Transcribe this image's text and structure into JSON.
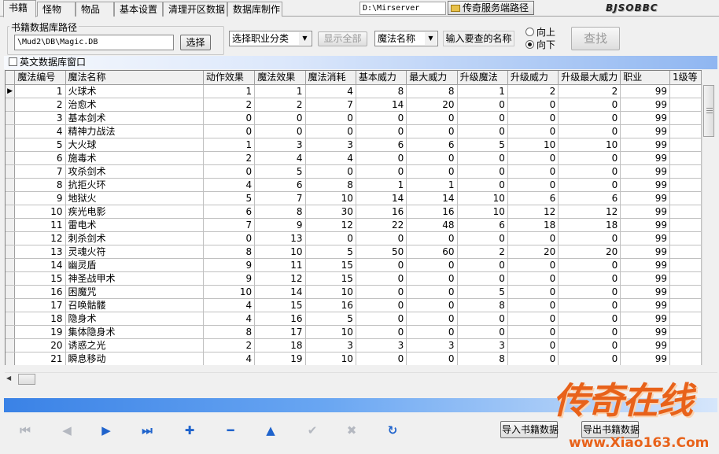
{
  "tabs": [
    {
      "label": "书籍",
      "active": true
    },
    {
      "label": "怪物",
      "active": false
    },
    {
      "label": "物品",
      "active": false
    },
    {
      "label": "基本设置",
      "active": false
    },
    {
      "label": "清理开区数据",
      "active": false
    },
    {
      "label": "数据库制作",
      "active": false
    }
  ],
  "server_path": "D:\\Mirserver",
  "server_path_button": "传奇服务端路径",
  "top_logo": "BJSOBBC",
  "db_group": {
    "title": "书籍数据库路径",
    "path": "\\Mud2\\DB\\Magic.DB",
    "select_label": "选择"
  },
  "filters": {
    "job_select": "选择职业分类",
    "show_all": "显示全部",
    "field_select": "魔法名称",
    "input_label": "输入要查的名称",
    "dir_up": "向上",
    "dir_down": "向下",
    "dir_selected": "down",
    "search": "查找"
  },
  "english_window": {
    "label": "英文数据库窗口",
    "checked": false
  },
  "grid": {
    "columns": [
      "魔法编号",
      "魔法名称",
      "动作效果",
      "魔法效果",
      "魔法消耗",
      "基本威力",
      "最大威力",
      "升级魔法",
      "升级威力",
      "升级最大威力",
      "职业",
      "1级等"
    ],
    "rows": [
      [
        "1",
        "火球术",
        "1",
        "1",
        "4",
        "8",
        "8",
        "1",
        "2",
        "2",
        "99"
      ],
      [
        "2",
        "治愈术",
        "2",
        "2",
        "7",
        "14",
        "20",
        "0",
        "0",
        "0",
        "99"
      ],
      [
        "3",
        "基本剑术",
        "0",
        "0",
        "0",
        "0",
        "0",
        "0",
        "0",
        "0",
        "99"
      ],
      [
        "4",
        "精神力战法",
        "0",
        "0",
        "0",
        "0",
        "0",
        "0",
        "0",
        "0",
        "99"
      ],
      [
        "5",
        "大火球",
        "1",
        "3",
        "3",
        "6",
        "6",
        "5",
        "10",
        "10",
        "99"
      ],
      [
        "6",
        "施毒术",
        "2",
        "4",
        "4",
        "0",
        "0",
        "0",
        "0",
        "0",
        "99"
      ],
      [
        "7",
        "攻杀剑术",
        "0",
        "5",
        "0",
        "0",
        "0",
        "0",
        "0",
        "0",
        "99"
      ],
      [
        "8",
        "抗拒火环",
        "4",
        "6",
        "8",
        "1",
        "1",
        "0",
        "0",
        "0",
        "99"
      ],
      [
        "9",
        "地狱火",
        "5",
        "7",
        "10",
        "14",
        "14",
        "10",
        "6",
        "6",
        "99"
      ],
      [
        "10",
        "疾光电影",
        "6",
        "8",
        "30",
        "16",
        "16",
        "10",
        "12",
        "12",
        "99"
      ],
      [
        "11",
        "雷电术",
        "7",
        "9",
        "12",
        "22",
        "48",
        "6",
        "18",
        "18",
        "99"
      ],
      [
        "12",
        "刺杀剑术",
        "0",
        "13",
        "0",
        "0",
        "0",
        "0",
        "0",
        "0",
        "99"
      ],
      [
        "13",
        "灵魂火符",
        "8",
        "10",
        "5",
        "50",
        "60",
        "2",
        "20",
        "20",
        "99"
      ],
      [
        "14",
        "幽灵盾",
        "9",
        "11",
        "15",
        "0",
        "0",
        "0",
        "0",
        "0",
        "99"
      ],
      [
        "15",
        "神圣战甲术",
        "9",
        "12",
        "15",
        "0",
        "0",
        "0",
        "0",
        "0",
        "99"
      ],
      [
        "16",
        "困魔咒",
        "10",
        "14",
        "10",
        "0",
        "0",
        "5",
        "0",
        "0",
        "99"
      ],
      [
        "17",
        "召唤骷髅",
        "4",
        "15",
        "16",
        "0",
        "0",
        "8",
        "0",
        "0",
        "99"
      ],
      [
        "18",
        "隐身术",
        "4",
        "16",
        "5",
        "0",
        "0",
        "0",
        "0",
        "0",
        "99"
      ],
      [
        "19",
        "集体隐身术",
        "8",
        "17",
        "10",
        "0",
        "0",
        "0",
        "0",
        "0",
        "99"
      ],
      [
        "20",
        "诱惑之光",
        "2",
        "18",
        "3",
        "3",
        "3",
        "3",
        "0",
        "0",
        "99"
      ],
      [
        "21",
        "瞬息移动",
        "4",
        "19",
        "10",
        "0",
        "0",
        "8",
        "0",
        "0",
        "99"
      ]
    ],
    "selected_row": 0
  },
  "navigator": [
    {
      "name": "nav-first-button",
      "glyph": "⏮",
      "enabled": false
    },
    {
      "name": "nav-prior-button",
      "glyph": "◀",
      "enabled": false
    },
    {
      "name": "nav-next-button",
      "glyph": "▶",
      "enabled": true
    },
    {
      "name": "nav-last-button",
      "glyph": "⏭",
      "enabled": true
    },
    {
      "name": "nav-insert-button",
      "glyph": "✚",
      "enabled": true
    },
    {
      "name": "nav-delete-button",
      "glyph": "━",
      "enabled": true
    },
    {
      "name": "nav-edit-button",
      "glyph": "▲",
      "enabled": true
    },
    {
      "name": "nav-post-button",
      "glyph": "✔",
      "enabled": false
    },
    {
      "name": "nav-cancel-button",
      "glyph": "✖",
      "enabled": false
    },
    {
      "name": "nav-refresh-button",
      "glyph": "↻",
      "enabled": true
    }
  ],
  "import_button": "导入书籍数据",
  "export_button": "导出书籍数据",
  "watermark": {
    "text": "传奇在线",
    "url": "www.Xiao163.Com"
  },
  "colors": {
    "nav_enabled": "#1f63cc",
    "nav_disabled": "#b4b8c0",
    "watermark": "#e8621a"
  }
}
